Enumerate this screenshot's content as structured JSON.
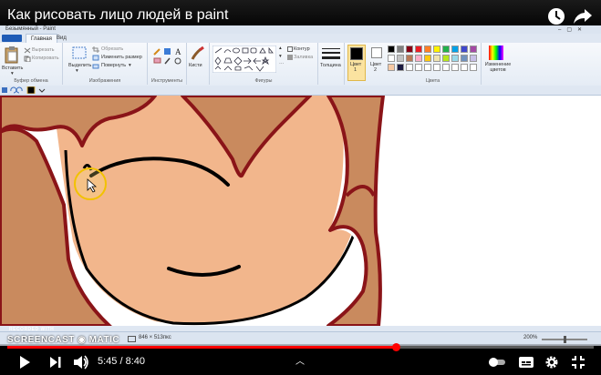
{
  "youtube": {
    "title": "Как рисовать лицо людей в paint",
    "time_current": "5:45",
    "time_separator": " / ",
    "time_total": "8:40",
    "progress": 0.663,
    "icons": [
      "watch-later-icon",
      "share-icon",
      "play-icon",
      "next-icon",
      "volume-icon",
      "autoplay-toggle-icon",
      "subtitles-icon",
      "settings-icon",
      "fullscreen-exit-icon",
      "chevron-up-icon"
    ]
  },
  "paint": {
    "window_title": "Безымянный - Paint",
    "tabs": {
      "home": "Главная",
      "view": "Вид"
    },
    "clipboard": {
      "paste": "Вставить",
      "cut": "Вырезать",
      "copy": "Копировать",
      "label": "Буфер обмена"
    },
    "image": {
      "select": "Выделить",
      "crop": "Обрезать",
      "resize": "Изменить размер",
      "rotate": "Повернуть",
      "label": "Изображения"
    },
    "tools": {
      "label": "Инструменты"
    },
    "brushes": {
      "label": "Кисти"
    },
    "shapes": {
      "outline": "Контур",
      "fill": "Заливка",
      "label": "Фигуры"
    },
    "size": {
      "label": "Толщина"
    },
    "color1": {
      "label": "Цвет",
      "num": "1"
    },
    "color2": {
      "label": "Цвет",
      "num": "2"
    },
    "colors": {
      "label": "Цвета",
      "edit": "Изменение цветов"
    },
    "status": {
      "size": "846 × 513пкс",
      "zoom": "200%"
    },
    "accent_colors": {
      "skin": "#f2b68c",
      "hair": "#c98a5e",
      "outline_hair": "#8a1418",
      "line": "#000000"
    }
  },
  "watermark": {
    "recorded": "RECORDED WITH",
    "name": "SCREENCAST ◉ MATIC"
  }
}
